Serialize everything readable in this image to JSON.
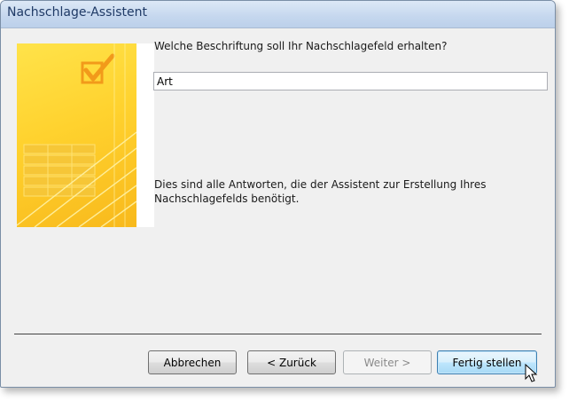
{
  "window": {
    "title": "Nachschlage-Assistent"
  },
  "main": {
    "question": "Welche Beschriftung soll Ihr Nachschlagefeld erhalten?",
    "caption_value": "Art",
    "info_text": "Dies sind alle Antworten, die der Assistent zur Erstellung Ihres Nachschlagefelds benötigt."
  },
  "buttons": {
    "cancel": "Abbrechen",
    "back": "< Zurück",
    "next": "Weiter >",
    "finish": "Fertig stellen"
  },
  "colors": {
    "wizard_yellow": "#ffd22e",
    "default_button_border": "#3c7fb1"
  },
  "icons": [
    "checkbox-check-icon",
    "mouse-pointer-icon"
  ]
}
